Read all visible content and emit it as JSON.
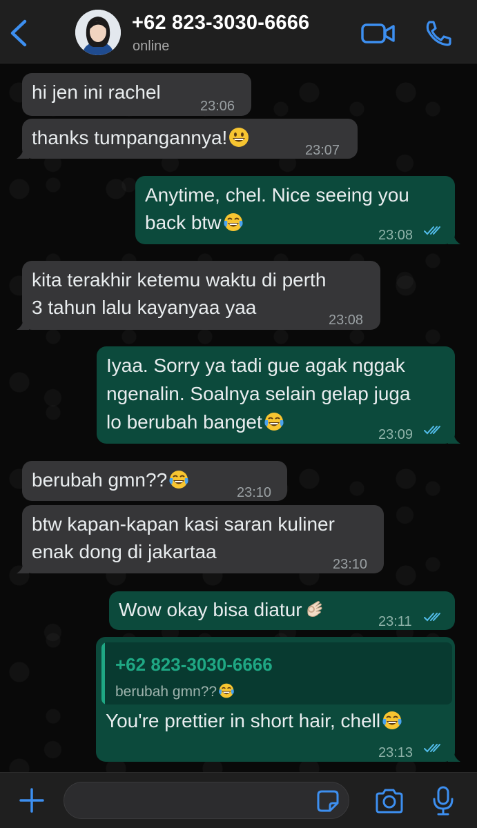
{
  "header": {
    "contact_name": "+62 823-3030-6666",
    "status": "online",
    "icons": [
      "chevron-left-icon",
      "avatar",
      "video-camera-icon",
      "phone-icon"
    ],
    "accent_color": "#3d8ff0"
  },
  "messages": [
    {
      "direction": "incoming",
      "text": "hi jen ini rachel",
      "time": "23:06"
    },
    {
      "direction": "incoming",
      "text": "thanks tumpangannya!",
      "emoji": "grinning-face",
      "time": "23:07"
    },
    {
      "direction": "outgoing",
      "lines": [
        "Anytime, chel. Nice seeing you",
        "back btw"
      ],
      "emoji": "face-with-tears-of-joy",
      "time": "23:08",
      "read": true
    },
    {
      "direction": "incoming",
      "lines": [
        "kita terakhir ketemu waktu di perth",
        "3 tahun lalu kayanyaa yaa"
      ],
      "time": "23:08"
    },
    {
      "direction": "outgoing",
      "lines": [
        "Iyaa. Sorry ya tadi gue agak nggak",
        "ngenalin. Soalnya selain gelap juga",
        "lo berubah banget"
      ],
      "emoji": "face-with-tears-of-joy",
      "time": "23:09",
      "read": true
    },
    {
      "direction": "incoming",
      "text": "berubah gmn??",
      "emoji": "face-with-tears-of-joy",
      "time": "23:10"
    },
    {
      "direction": "incoming",
      "lines": [
        "btw kapan-kapan kasi saran kuliner",
        "enak dong di jakartaa"
      ],
      "time": "23:10"
    },
    {
      "direction": "outgoing",
      "text": "Wow okay bisa diatur",
      "emoji": "ok-hand",
      "time": "23:11",
      "read": true
    },
    {
      "direction": "outgoing",
      "quote": {
        "name": "+62 823-3030-6666",
        "text": "berubah gmn??",
        "emoji": "face-with-tears-of-joy"
      },
      "text": "You're prettier in short hair, chell",
      "emoji": "face-with-tears-of-joy",
      "time": "23:13",
      "read": true
    }
  ],
  "input_bar": {
    "placeholder": "",
    "icons": [
      "plus-icon",
      "sticker-icon",
      "camera-icon",
      "microphone-icon"
    ]
  },
  "colors": {
    "incoming_bubble": "#363638",
    "outgoing_bubble": "#0c4a3c",
    "read_ticks": "#53bdeb",
    "quote_accent": "#1fa884"
  }
}
